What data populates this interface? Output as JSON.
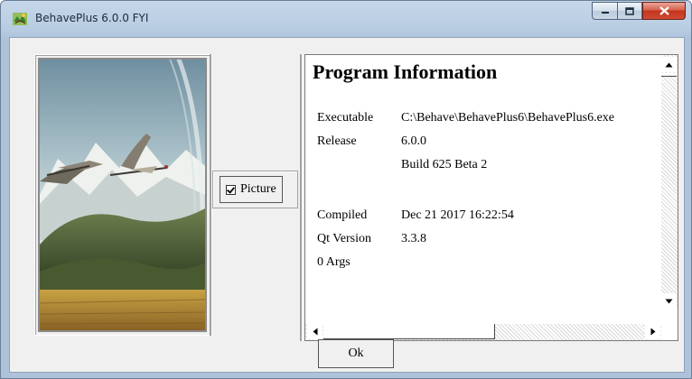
{
  "window": {
    "title": "BehavePlus 6.0.0 FYI",
    "icons": [
      "app-icon",
      "minimize-icon",
      "maximize-icon",
      "close-icon"
    ]
  },
  "picture_toggle": {
    "label": "Picture",
    "checked": true
  },
  "info": {
    "heading": "Program Information",
    "rows": [
      {
        "label": "Executable",
        "value": "C:\\Behave\\BehavePlus6\\BehavePlus6.exe"
      },
      {
        "label": "Release",
        "value": "6.0.0"
      },
      {
        "label": "",
        "value": "Build 625 Beta 2"
      },
      {
        "label": "Compiled",
        "value": "Dec 21 2017 16:22:54"
      },
      {
        "label": "Qt Version",
        "value": "3.3.8"
      },
      {
        "label": "0 Args",
        "value": ""
      }
    ]
  },
  "ok_label": "Ok",
  "colors": {
    "close_red": "#c3341e",
    "titlebar": "#b9cde2",
    "dialog_bg": "#f0f0f0"
  }
}
